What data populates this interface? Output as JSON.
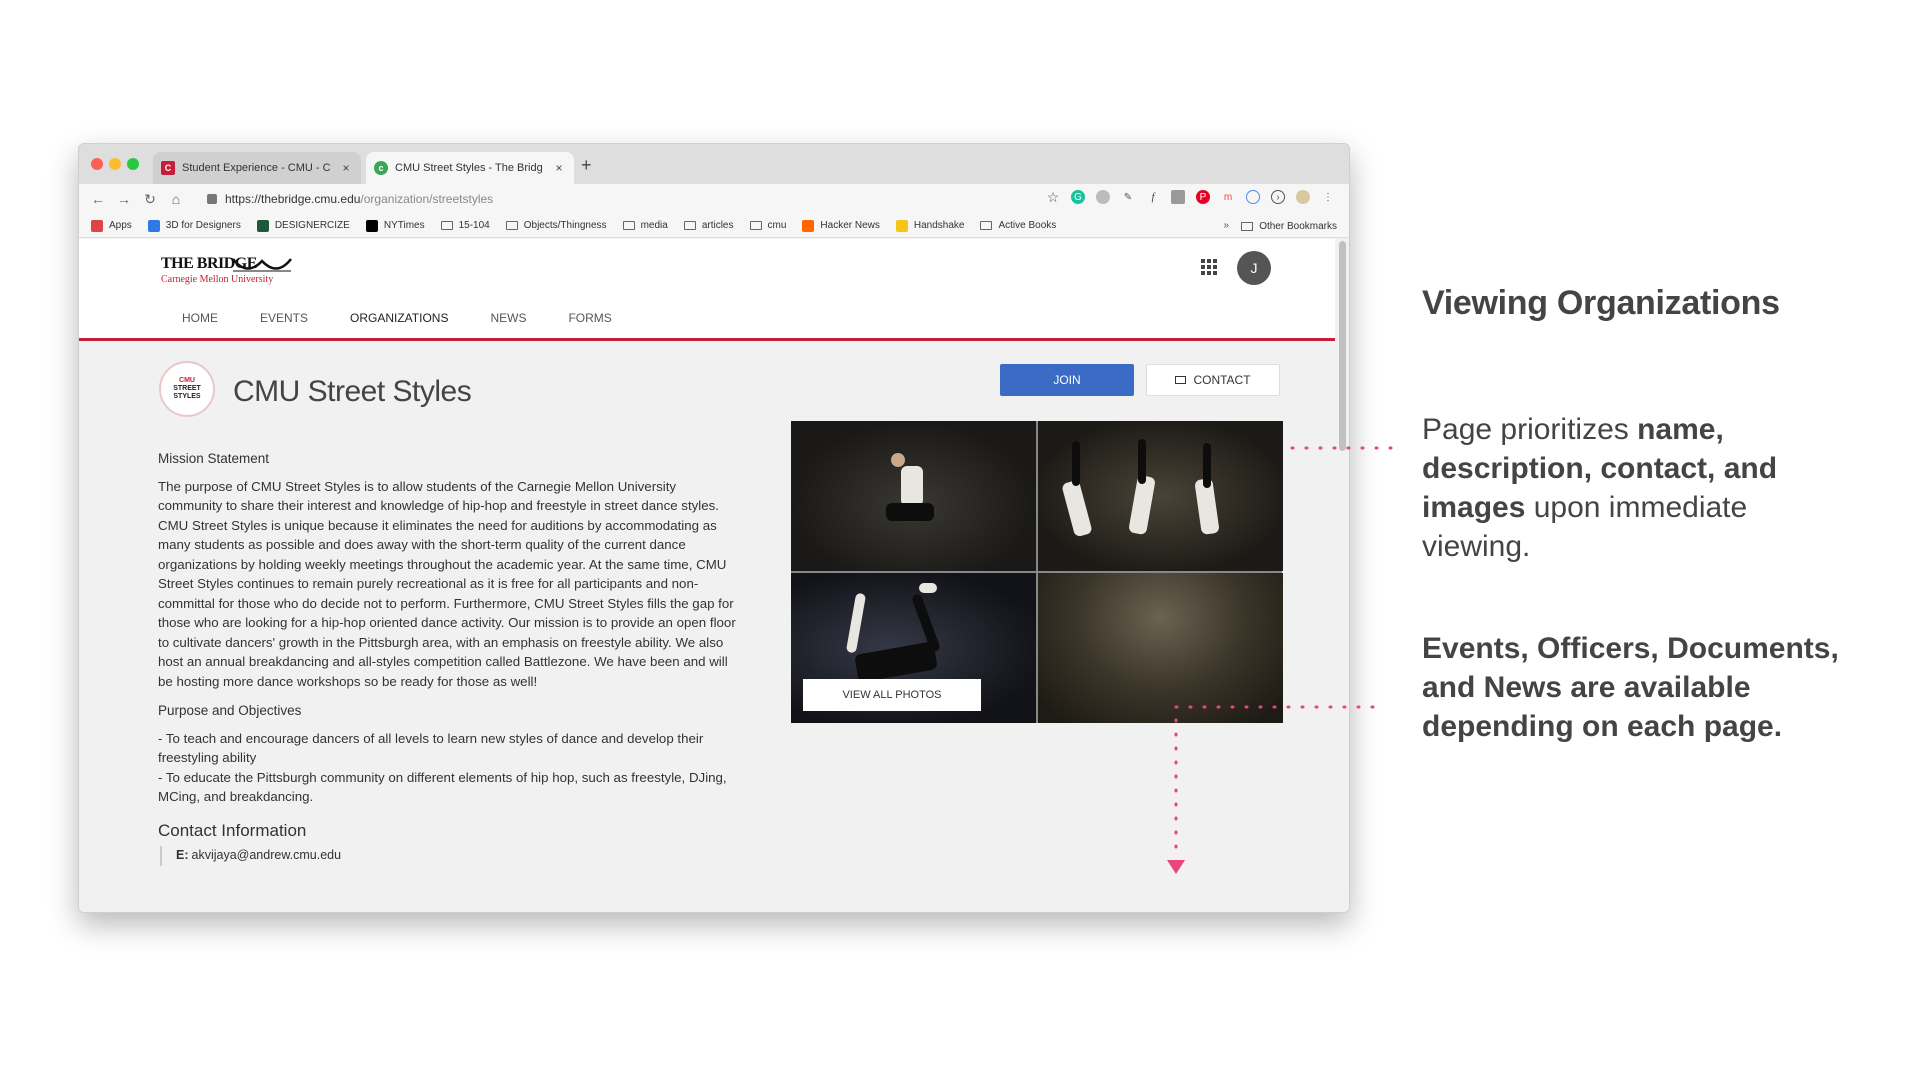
{
  "browser": {
    "tabs": [
      {
        "title": "Student Experience - CMU - C",
        "favicon": "cmu-icon",
        "color": "#c41e3a"
      },
      {
        "title": "CMU Street Styles - The Bridg",
        "favicon": "bridge-icon",
        "color": "#3aa757"
      }
    ],
    "url": {
      "base": "https://thebridge.cmu.edu",
      "path": "/organization/streetstyles"
    },
    "bookmarks": [
      {
        "label": "Apps",
        "icon": "apps-grid-icon",
        "color": "#d44"
      },
      {
        "label": "3D for Designers",
        "icon": "bookmark-icon",
        "color": "#2c7be5"
      },
      {
        "label": "DESIGNERCIZE",
        "icon": "bookmark-icon",
        "color": "#1d5a3a"
      },
      {
        "label": "NYTimes",
        "icon": "nyt-icon",
        "color": "#000000"
      },
      {
        "label": "15-104",
        "icon": "folder-icon",
        "color": ""
      },
      {
        "label": "Objects/Thingness",
        "icon": "folder-icon",
        "color": ""
      },
      {
        "label": "media",
        "icon": "folder-icon",
        "color": ""
      },
      {
        "label": "articles",
        "icon": "folder-icon",
        "color": ""
      },
      {
        "label": "cmu",
        "icon": "folder-icon",
        "color": ""
      },
      {
        "label": "Hacker News",
        "icon": "hn-icon",
        "color": "#ff6600"
      },
      {
        "label": "Handshake",
        "icon": "handshake-icon",
        "color": "#f5c518"
      },
      {
        "label": "Active Books",
        "icon": "folder-icon",
        "color": ""
      }
    ],
    "bookmarks_more": "»",
    "other_bookmarks": "Other Bookmarks"
  },
  "site": {
    "logo_main": "THE BRIDGE",
    "logo_sub": "Carnegie Mellon University",
    "avatar_initial": "J",
    "nav": [
      "HOME",
      "EVENTS",
      "ORGANIZATIONS",
      "NEWS",
      "FORMS"
    ],
    "nav_active": "ORGANIZATIONS",
    "accent_color": "#c41e3a"
  },
  "org": {
    "logo_lines": [
      "CMU",
      "STREET",
      "STYLES"
    ],
    "name": "CMU Street Styles",
    "join_label": "JOIN",
    "contact_label": "CONTACT",
    "mission_heading": "Mission Statement",
    "mission_text": "The purpose of CMU Street Styles is to allow students of the Carnegie Mellon University community to share their interest and knowledge of hip-hop and freestyle in street dance styles. CMU Street Styles is unique because it eliminates the need for auditions by accommodating as many students as possible and does away with the short-term quality of the current dance organizations by holding weekly meetings throughout the academic year. At the same time, CMU Street Styles continues to remain purely recreational as it is free for all participants and non-committal for those who do decide not to perform. Furthermore, CMU Street Styles fills the gap for those who are looking for a hip-hop oriented dance activity. Our mission is to provide an open floor to cultivate dancers' growth in the Pittsburgh area, with an emphasis on freestyle ability. We also host an annual breakdancing and all-styles competition called Battlezone. We have been and will be hosting more dance workshops so be ready for those as well!",
    "purpose_heading": "Purpose and Objectives",
    "purpose_items": [
      "- To teach and encourage dancers of all levels to learn new styles of dance and develop their freestyling ability",
      "- To educate the Pittsburgh community on different elements of hip hop, such as freestyle, DJing, MCing, and breakdancing."
    ],
    "contact_heading": "Contact Information",
    "contact_email_label": "E:",
    "contact_email": "akvijaya@andrew.cmu.edu",
    "view_all_photos": "VIEW ALL PHOTOS"
  },
  "annotations": {
    "title": "Viewing Organizations",
    "note1_prefix": "Page prioritizes ",
    "note1_bold": "name, description, contact, and images",
    "note1_suffix": " upon immediate viewing.",
    "note2": "Events, Officers, Documents, and News are available depending on each page.",
    "accent_color": "#e8457f"
  }
}
